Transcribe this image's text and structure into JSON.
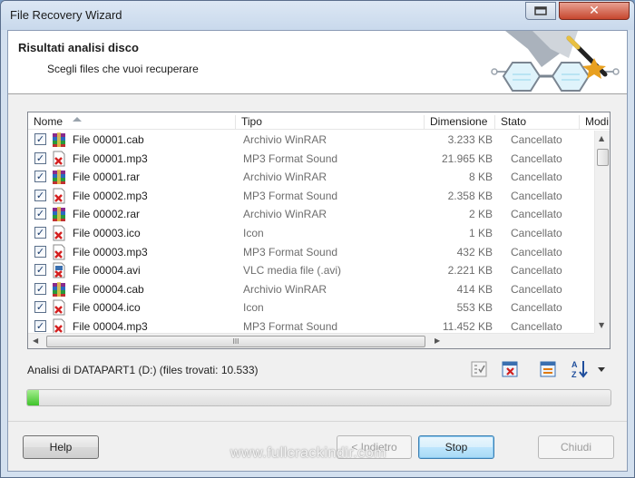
{
  "window": {
    "title": "File Recovery Wizard",
    "close_glyph": "✕"
  },
  "header": {
    "title": "Risultati analisi disco",
    "subtitle": "Scegli files che vuoi recuperare"
  },
  "list": {
    "columns": [
      "Nome",
      "Tipo",
      "Dimensione",
      "Stato",
      "Modi"
    ],
    "rows": [
      {
        "name": "File 00001.cab",
        "type": "Archivio WinRAR",
        "size": "3.233 KB",
        "state": "Cancellato",
        "icon": "winrar-icon"
      },
      {
        "name": "File 00001.mp3",
        "type": "MP3 Format Sound",
        "size": "21.965 KB",
        "state": "Cancellato",
        "icon": "damaged-file-icon"
      },
      {
        "name": "File 00001.rar",
        "type": "Archivio WinRAR",
        "size": "8 KB",
        "state": "Cancellato",
        "icon": "winrar-icon"
      },
      {
        "name": "File 00002.mp3",
        "type": "MP3 Format Sound",
        "size": "2.358 KB",
        "state": "Cancellato",
        "icon": "damaged-file-icon"
      },
      {
        "name": "File 00002.rar",
        "type": "Archivio WinRAR",
        "size": "2 KB",
        "state": "Cancellato",
        "icon": "winrar-icon"
      },
      {
        "name": "File 00003.ico",
        "type": "Icon",
        "size": "1 KB",
        "state": "Cancellato",
        "icon": "damaged-file-icon"
      },
      {
        "name": "File 00003.mp3",
        "type": "MP3 Format Sound",
        "size": "432 KB",
        "state": "Cancellato",
        "icon": "damaged-file-icon"
      },
      {
        "name": "File 00004.avi",
        "type": "VLC media file (.avi)",
        "size": "2.221 KB",
        "state": "Cancellato",
        "icon": "damaged-video-icon"
      },
      {
        "name": "File 00004.cab",
        "type": "Archivio WinRAR",
        "size": "414 KB",
        "state": "Cancellato",
        "icon": "winrar-icon"
      },
      {
        "name": "File 00004.ico",
        "type": "Icon",
        "size": "553 KB",
        "state": "Cancellato",
        "icon": "damaged-file-icon"
      },
      {
        "name": "File 00004.mp3",
        "type": "MP3 Format Sound",
        "size": "11.452 KB",
        "state": "Cancellato",
        "icon": "damaged-file-icon"
      }
    ],
    "checkbox_glyph": "✓",
    "hscroll_grip": "III"
  },
  "status": {
    "text": "Analisi di DATAPART1 (D:) (files trovati: 10.533)"
  },
  "progress": {
    "fraction": 0.02
  },
  "buttons": {
    "help": "Help",
    "back": "< Indietro",
    "stop": "Stop",
    "close": "Chiudi"
  },
  "watermark": "www.fullcrackindir.com",
  "colors": {
    "progress": "#3fc32a",
    "accent": "#3c7fb1"
  }
}
